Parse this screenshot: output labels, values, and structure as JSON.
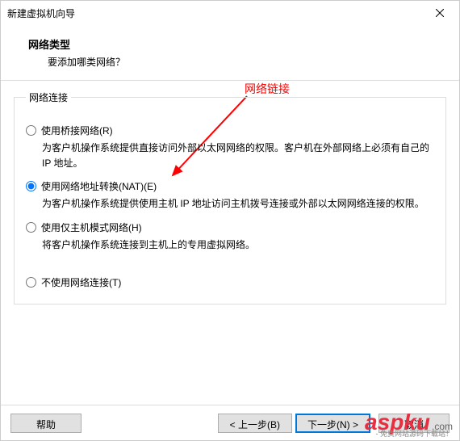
{
  "window": {
    "title": "新建虚拟机向导"
  },
  "header": {
    "title": "网络类型",
    "subtitle": "要添加哪类网络？"
  },
  "fieldset": {
    "legend": "网络连接"
  },
  "options": {
    "bridged": {
      "label": "使用桥接网络(R)",
      "desc": "为客户机操作系统提供直接访问外部以太网网络的权限。客户机在外部网络上必须有自己的 IP 地址。"
    },
    "nat": {
      "label": "使用网络地址转换(NAT)(E)",
      "desc": "为客户机操作系统提供使用主机 IP 地址访问主机拨号连接或外部以太网网络连接的权限。"
    },
    "hostonly": {
      "label": "使用仅主机模式网络(H)",
      "desc": "将客户机操作系统连接到主机上的专用虚拟网络。"
    },
    "none": {
      "label": "不使用网络连接(T)"
    }
  },
  "annotation": {
    "text": "网络链接"
  },
  "buttons": {
    "help": "帮助",
    "back": "< 上一步(B)",
    "next": "下一步(N) >",
    "cancel": "取消"
  },
  "watermark": {
    "brand": "aspku",
    "tld": ".com",
    "sub": "- 免费网站源码下载站！"
  }
}
